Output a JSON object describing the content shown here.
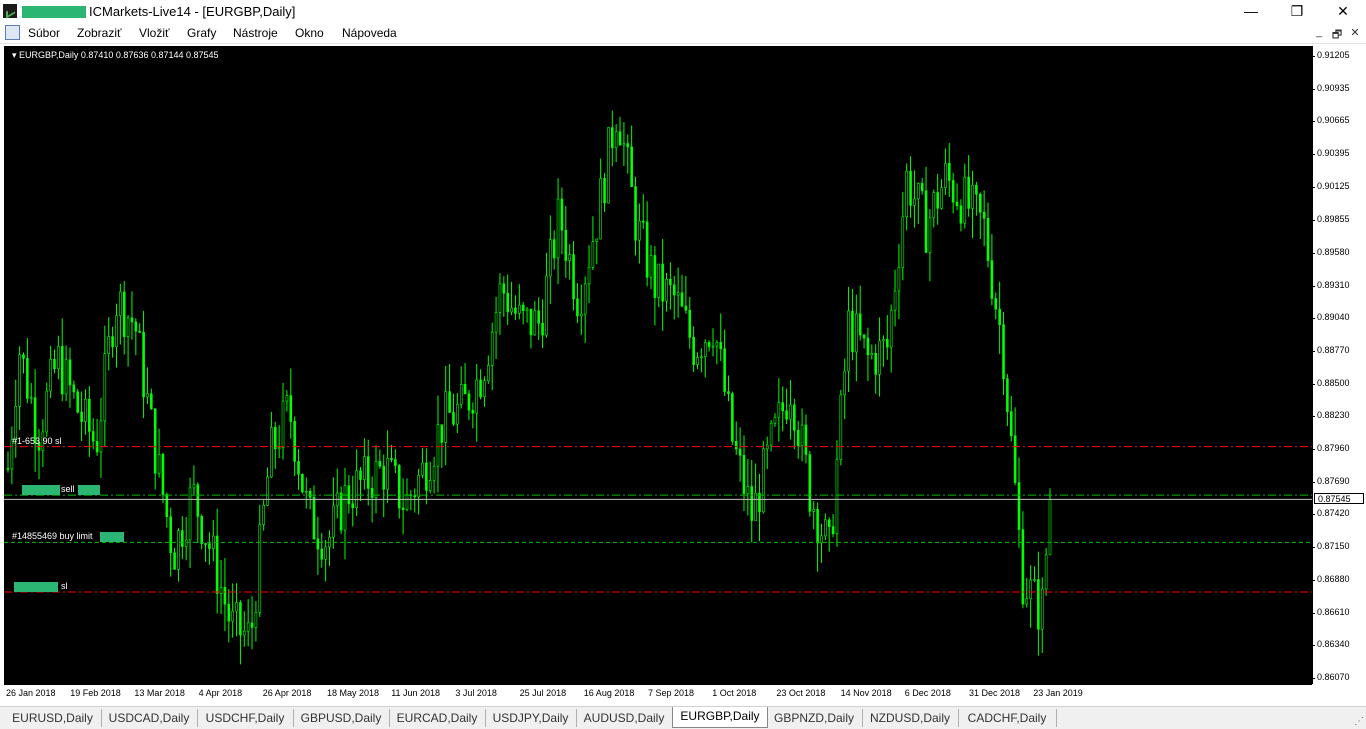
{
  "window": {
    "title": "ICMarkets-Live14 - [EURGBP,Daily]",
    "minimize": "—",
    "maximize": "❐",
    "close": "✕"
  },
  "menu": {
    "items": [
      "Súbor",
      "Zobraziť",
      "Vložiť",
      "Grafy",
      "Nástroje",
      "Okno",
      "Nápoveda"
    ],
    "mdi_minimize": "_",
    "mdi_restore": "🗗",
    "mdi_close": "✕"
  },
  "chart": {
    "header": "EURGBP,Daily  0.87410 0.87636 0.87144 0.87545",
    "current_price": "0.87545",
    "background": "#000000",
    "candle_color": "#00ff00",
    "price_ticks": [
      "0.91205",
      "0.90935",
      "0.90665",
      "0.90395",
      "0.90125",
      "0.89855",
      "0.89580",
      "0.89310",
      "0.89040",
      "0.88770",
      "0.88500",
      "0.88230",
      "0.87960",
      "0.87690",
      "0.87420",
      "0.87150",
      "0.86880",
      "0.86610",
      "0.86340",
      "0.86070"
    ],
    "time_ticks": [
      "26 Jan 2018",
      "19 Feb 2018",
      "13 Mar 2018",
      "4 Apr 2018",
      "26 Apr 2018",
      "18 May 2018",
      "11 Jun 2018",
      "3 Jul 2018",
      "25 Jul 2018",
      "16 Aug 2018",
      "7 Sep 2018",
      "1 Oct 2018",
      "23 Oct 2018",
      "14 Nov 2018",
      "6 Dec 2018",
      "31 Dec 2018",
      "23 Jan 2019"
    ],
    "order_lines": [
      {
        "label": "#1-653 90 sl",
        "color": "#ff0000",
        "style": "dash-dot"
      },
      {
        "label": "sell",
        "color": "#00c000",
        "style": "dash-dot"
      },
      {
        "label": "#14855469 buy limit",
        "color": "#00c000",
        "style": "dash"
      },
      {
        "label": "sl",
        "color": "#ff0000",
        "style": "dash-dot"
      }
    ]
  },
  "chart_data": {
    "type": "candlestick",
    "symbol": "EURGBP",
    "timeframe": "Daily",
    "last": {
      "open": 0.8741,
      "high": 0.87636,
      "low": 0.87144,
      "close": 0.87545
    },
    "ylim": [
      0.8607,
      0.91205
    ],
    "order_levels": [
      0.8798,
      0.8758,
      0.8719,
      0.8678
    ],
    "close_path": [
      {
        "date": "2018-01-22",
        "close": 0.878
      },
      {
        "date": "2018-01-26",
        "close": 0.888
      },
      {
        "date": "2018-02-02",
        "close": 0.881
      },
      {
        "date": "2018-02-09",
        "close": 0.887
      },
      {
        "date": "2018-02-16",
        "close": 0.883
      },
      {
        "date": "2018-02-23",
        "close": 0.88
      },
      {
        "date": "2018-03-02",
        "close": 0.892
      },
      {
        "date": "2018-03-09",
        "close": 0.89
      },
      {
        "date": "2018-03-16",
        "close": 0.88
      },
      {
        "date": "2018-03-23",
        "close": 0.871
      },
      {
        "date": "2018-03-30",
        "close": 0.876
      },
      {
        "date": "2018-04-06",
        "close": 0.871
      },
      {
        "date": "2018-04-13",
        "close": 0.865
      },
      {
        "date": "2018-04-20",
        "close": 0.864
      },
      {
        "date": "2018-04-27",
        "close": 0.879
      },
      {
        "date": "2018-05-04",
        "close": 0.883
      },
      {
        "date": "2018-05-11",
        "close": 0.874
      },
      {
        "date": "2018-05-18",
        "close": 0.872
      },
      {
        "date": "2018-05-25",
        "close": 0.876
      },
      {
        "date": "2018-06-01",
        "close": 0.877
      },
      {
        "date": "2018-06-08",
        "close": 0.878
      },
      {
        "date": "2018-06-15",
        "close": 0.875
      },
      {
        "date": "2018-06-22",
        "close": 0.878
      },
      {
        "date": "2018-06-29",
        "close": 0.882
      },
      {
        "date": "2018-07-06",
        "close": 0.883
      },
      {
        "date": "2018-07-13",
        "close": 0.886
      },
      {
        "date": "2018-07-20",
        "close": 0.893
      },
      {
        "date": "2018-07-27",
        "close": 0.89
      },
      {
        "date": "2018-08-03",
        "close": 0.89
      },
      {
        "date": "2018-08-10",
        "close": 0.899
      },
      {
        "date": "2018-08-17",
        "close": 0.892
      },
      {
        "date": "2018-08-24",
        "close": 0.899
      },
      {
        "date": "2018-08-31",
        "close": 0.908
      },
      {
        "date": "2018-09-07",
        "close": 0.898
      },
      {
        "date": "2018-09-14",
        "close": 0.893
      },
      {
        "date": "2018-09-21",
        "close": 0.892
      },
      {
        "date": "2018-09-28",
        "close": 0.888
      },
      {
        "date": "2018-10-05",
        "close": 0.89
      },
      {
        "date": "2018-10-12",
        "close": 0.88
      },
      {
        "date": "2018-10-19",
        "close": 0.874
      },
      {
        "date": "2018-10-26",
        "close": 0.88
      },
      {
        "date": "2018-11-02",
        "close": 0.885
      },
      {
        "date": "2018-11-09",
        "close": 0.876
      },
      {
        "date": "2018-11-16",
        "close": 0.871
      },
      {
        "date": "2018-11-23",
        "close": 0.89
      },
      {
        "date": "2018-11-30",
        "close": 0.887
      },
      {
        "date": "2018-12-07",
        "close": 0.888
      },
      {
        "date": "2018-12-14",
        "close": 0.902
      },
      {
        "date": "2018-12-21",
        "close": 0.898
      },
      {
        "date": "2018-12-28",
        "close": 0.902
      },
      {
        "date": "2019-01-04",
        "close": 0.9
      },
      {
        "date": "2019-01-11",
        "close": 0.898
      },
      {
        "date": "2019-01-18",
        "close": 0.888
      },
      {
        "date": "2019-01-25",
        "close": 0.869
      },
      {
        "date": "2019-02-01",
        "close": 0.866
      },
      {
        "date": "2019-02-04",
        "close": 0.8755
      }
    ]
  },
  "tabs": [
    "EURUSD,Daily",
    "USDCAD,Daily",
    "USDCHF,Daily",
    "GBPUSD,Daily",
    "EURCAD,Daily",
    "USDJPY,Daily",
    "AUDUSD,Daily",
    "EURGBP,Daily",
    "GBPNZD,Daily",
    "NZDUSD,Daily",
    "CADCHF,Daily"
  ],
  "active_tab": "EURGBP,Daily"
}
